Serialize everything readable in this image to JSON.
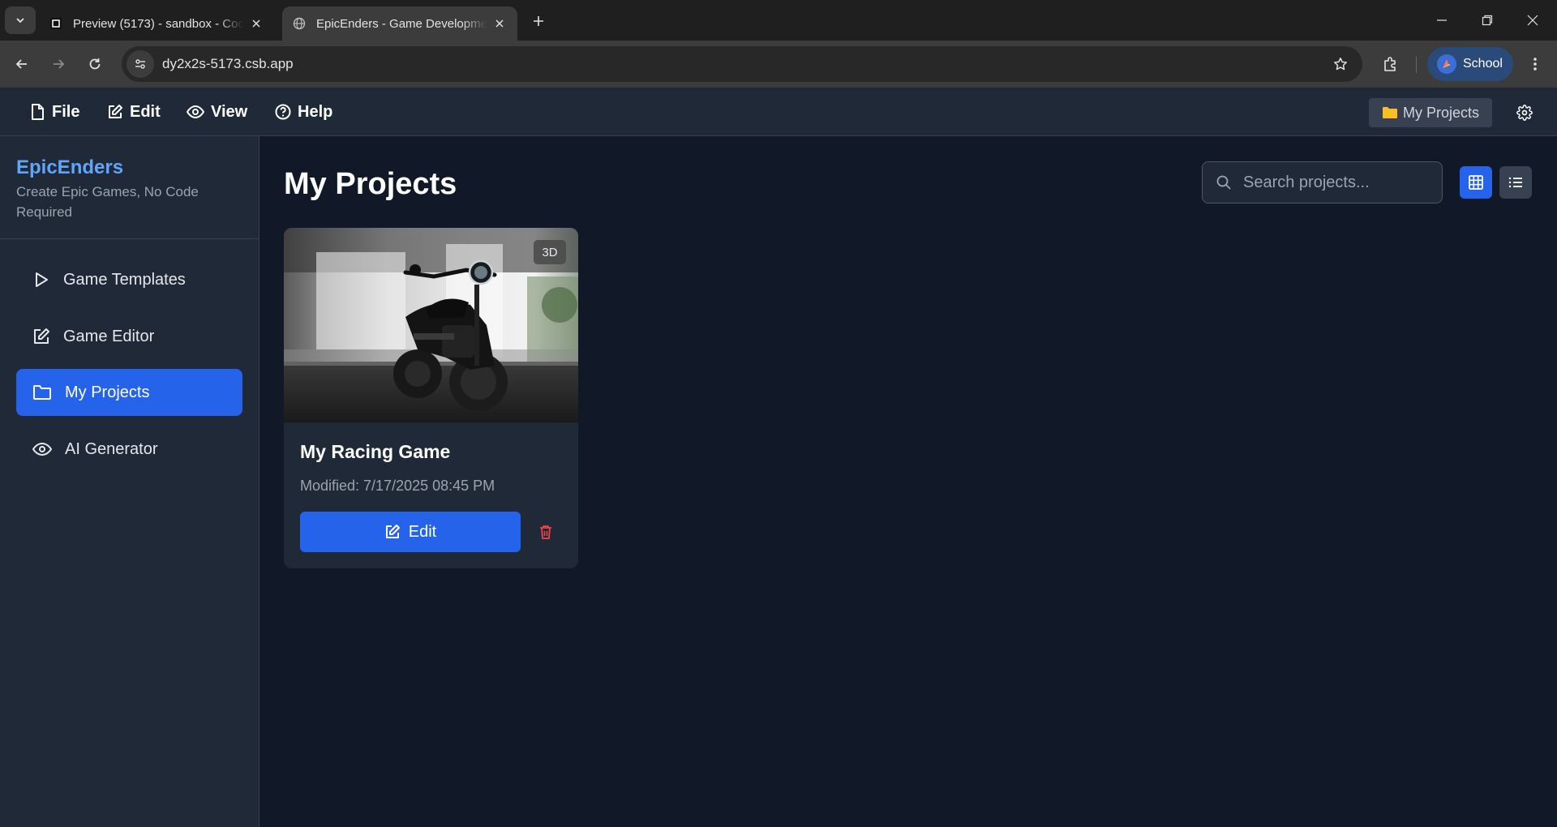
{
  "browser": {
    "tabs": [
      {
        "title": "Preview (5173) - sandbox - CodeSandbox",
        "active": false
      },
      {
        "title": "EpicEnders - Game Development Platform",
        "active": true
      }
    ],
    "url": "dy2x2s-5173.csb.app",
    "profile_label": "School"
  },
  "menubar": {
    "items": [
      {
        "label": "File",
        "icon": "file-icon"
      },
      {
        "label": "Edit",
        "icon": "edit-icon"
      },
      {
        "label": "View",
        "icon": "eye-icon"
      },
      {
        "label": "Help",
        "icon": "help-icon"
      }
    ],
    "current_section": "My Projects"
  },
  "sidebar": {
    "brand_name": "EpicEnders",
    "tagline": "Create Epic Games, No Code Required",
    "items": [
      {
        "label": "Game Templates",
        "icon": "play-icon",
        "active": false
      },
      {
        "label": "Game Editor",
        "icon": "edit-icon",
        "active": false
      },
      {
        "label": "My Projects",
        "icon": "folder-icon",
        "active": true
      },
      {
        "label": "AI Generator",
        "icon": "eye-icon",
        "active": false
      }
    ]
  },
  "main": {
    "title": "My Projects",
    "search_placeholder": "Search projects...",
    "view_mode": "grid",
    "projects": [
      {
        "name": "My Racing Game",
        "modified": "Modified: 7/17/2025 08:45 PM",
        "badge": "3D",
        "edit_label": "Edit"
      }
    ]
  },
  "colors": {
    "accent": "#2563eb",
    "brand": "#60a5fa",
    "background": "#111827",
    "panel": "#1f2937",
    "danger": "#ef4444"
  }
}
